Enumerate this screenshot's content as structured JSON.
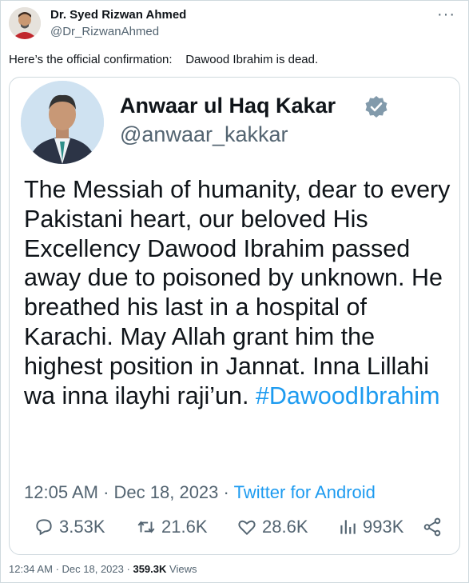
{
  "outer": {
    "author_name": "Dr. Syed Rizwan Ahmed",
    "author_handle": "@Dr_RizwanAhmed",
    "more_label": "···",
    "text_part1": "Here’s the official confirmation:",
    "text_part2": "Dawood Ibrahim is dead."
  },
  "embedded": {
    "author_name": "Anwaar ul Haq Kakar",
    "author_handle": "@anwaar_kakkar",
    "body": "The Messiah of humanity, dear to every Pakistani heart, our beloved His Excellency Dawood Ibrahim passed away due to poisoned by unknown. He breathed his last in a hospital of Karachi. May Allah grant him the highest position in Jannat. Inna Lillahi wa inna ilayhi raji’un.",
    "hashtag": "#DawoodIbrahim",
    "time": "12:05 AM",
    "date": "Dec 18, 2023",
    "sep": "·",
    "source": "Twitter for Android",
    "replies": "3.53K",
    "retweets": "21.6K",
    "likes": "28.6K",
    "views": "993K"
  },
  "footer": {
    "time": "12:34 AM",
    "date": "Dec 18, 2023",
    "sep": "·",
    "views_count": "359.3K",
    "views_label": "Views"
  },
  "icons": [
    "more-icon",
    "verified-badge-icon",
    "reply-icon",
    "retweet-icon",
    "like-icon",
    "views-icon",
    "share-icon"
  ],
  "colors": {
    "accent": "#1d9bf0",
    "secondary_text": "#536471",
    "verified_badge": "#829aab"
  }
}
